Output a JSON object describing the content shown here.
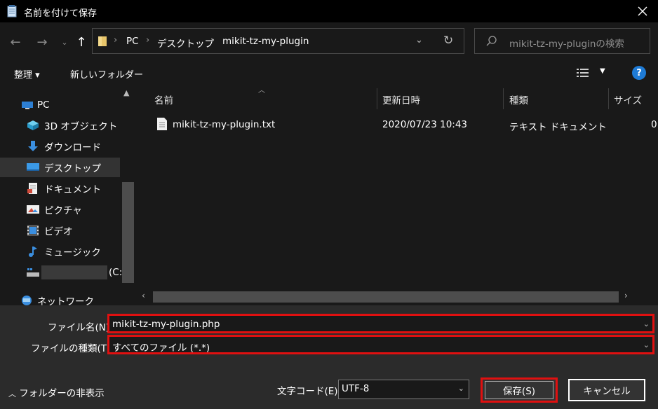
{
  "window": {
    "title": "名前を付けて保存"
  },
  "nav": {
    "breadcrumb": [
      "PC",
      "デスクトップ",
      "mikit-tz-my-plugin"
    ],
    "search_placeholder": "mikit-tz-my-pluginの検索"
  },
  "toolbar": {
    "organize": "整理 ▾",
    "new_folder": "新しいフォルダー"
  },
  "sidebar": {
    "items": [
      {
        "label": "PC",
        "icon": "pc-icon"
      },
      {
        "label": "3D オブジェクト",
        "icon": "3d-objects-icon"
      },
      {
        "label": "ダウンロード",
        "icon": "download-icon"
      },
      {
        "label": "デスクトップ",
        "icon": "desktop-icon",
        "selected": true
      },
      {
        "label": "ドキュメント",
        "icon": "documents-icon"
      },
      {
        "label": "ピクチャ",
        "icon": "pictures-icon"
      },
      {
        "label": "ビデオ",
        "icon": "videos-icon"
      },
      {
        "label": "ミュージック",
        "icon": "music-icon"
      },
      {
        "label": "(C:",
        "icon": "drive-icon"
      },
      {
        "label": "ネットワーク",
        "icon": "network-icon"
      }
    ]
  },
  "columns": {
    "name": "名前",
    "modified": "更新日時",
    "type": "種類",
    "size": "サイズ"
  },
  "files": [
    {
      "name": "mikit-tz-my-plugin.txt",
      "modified": "2020/07/23 10:43",
      "type": "テキスト ドキュメント",
      "size": "0"
    }
  ],
  "form": {
    "filename_label": "ファイル名(N):",
    "filename_value": "mikit-tz-my-plugin.php",
    "filetype_label": "ファイルの種類(T):",
    "filetype_value": "すべてのファイル  (*.*)",
    "hide_folders": "フォルダーの非表示",
    "encoding_label": "文字コード(E):",
    "encoding_value": "UTF-8",
    "save_button": "保存(S)",
    "cancel_button": "キャンセル"
  },
  "colors": {
    "highlight": "#e01010",
    "selected_bg": "#333333",
    "accent": "#1e7bd6"
  }
}
